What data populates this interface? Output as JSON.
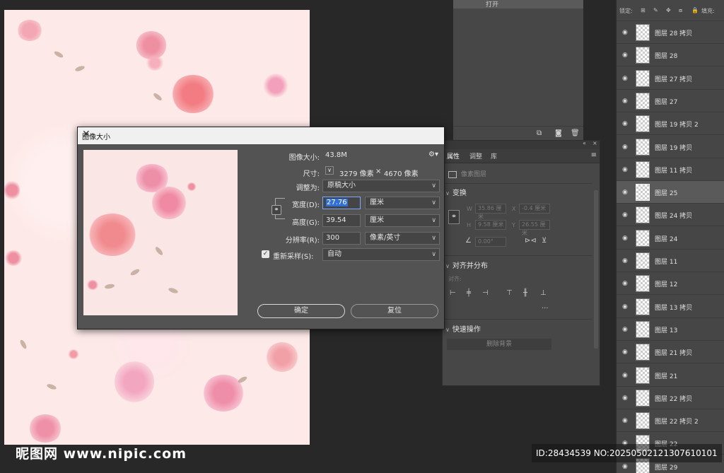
{
  "history": {
    "item": "打开"
  },
  "properties": {
    "tabs": [
      "属性",
      "调整",
      "库"
    ],
    "subtitle": "像素图层",
    "transform": {
      "title": "变换",
      "w_label": "W",
      "w_value": "35.86 厘米",
      "x_label": "X",
      "x_value": "-0.4 厘米",
      "h_label": "H",
      "h_value": "9.58 厘米",
      "y_label": "Y",
      "y_value": "26.55 厘米",
      "angle_value": "0.00°"
    },
    "align": {
      "title": "对齐并分布",
      "label": "对齐:"
    },
    "quick": {
      "title": "快速操作",
      "remove_bg": "删除背景"
    }
  },
  "layers": {
    "lock_label": "锁定:",
    "fill_label": "填充:",
    "items": [
      {
        "name": "图层 28 拷贝",
        "selected": false
      },
      {
        "name": "图层 28",
        "selected": false
      },
      {
        "name": "图层 27 拷贝",
        "selected": false
      },
      {
        "name": "图层 27",
        "selected": false
      },
      {
        "name": "图层 19 拷贝 2",
        "selected": false
      },
      {
        "name": "图层 19 拷贝",
        "selected": false
      },
      {
        "name": "图层 11 拷贝",
        "selected": false
      },
      {
        "name": "图层 25",
        "selected": true
      },
      {
        "name": "图层 24 拷贝",
        "selected": false
      },
      {
        "name": "图层 24",
        "selected": false
      },
      {
        "name": "图层 11",
        "selected": false
      },
      {
        "name": "图层 12",
        "selected": false
      },
      {
        "name": "图层 13 拷贝",
        "selected": false
      },
      {
        "name": "图层 13",
        "selected": false
      },
      {
        "name": "图层 21 拷贝",
        "selected": false
      },
      {
        "name": "图层 21",
        "selected": false
      },
      {
        "name": "图层 22 拷贝",
        "selected": false
      },
      {
        "name": "图层 22 拷贝 2",
        "selected": false
      },
      {
        "name": "图层 22",
        "selected": false
      },
      {
        "name": "图层 29",
        "selected": false
      }
    ]
  },
  "dialog": {
    "title": "图像大小",
    "image_size_label": "图像大小:",
    "image_size_value": "43.8M",
    "dimensions_label": "尺寸:",
    "dimensions_w": "3279 像素",
    "dimensions_sep": "×",
    "dimensions_h": "4670 像素",
    "fit_label": "调整为:",
    "fit_value": "原稿大小",
    "width_label": "宽度(D):",
    "width_value": "27.76",
    "width_unit": "厘米",
    "height_label": "高度(G):",
    "height_value": "39.54",
    "height_unit": "厘米",
    "resolution_label": "分辨率(R):",
    "resolution_value": "300",
    "resolution_unit": "像素/英寸",
    "resample_label": "重新采样(S):",
    "resample_value": "自动",
    "ok": "确定",
    "reset": "复位"
  },
  "watermark": {
    "left": "昵图网 www.nipic.com",
    "right": "ID:28434539 NO:20250502121307610101"
  }
}
